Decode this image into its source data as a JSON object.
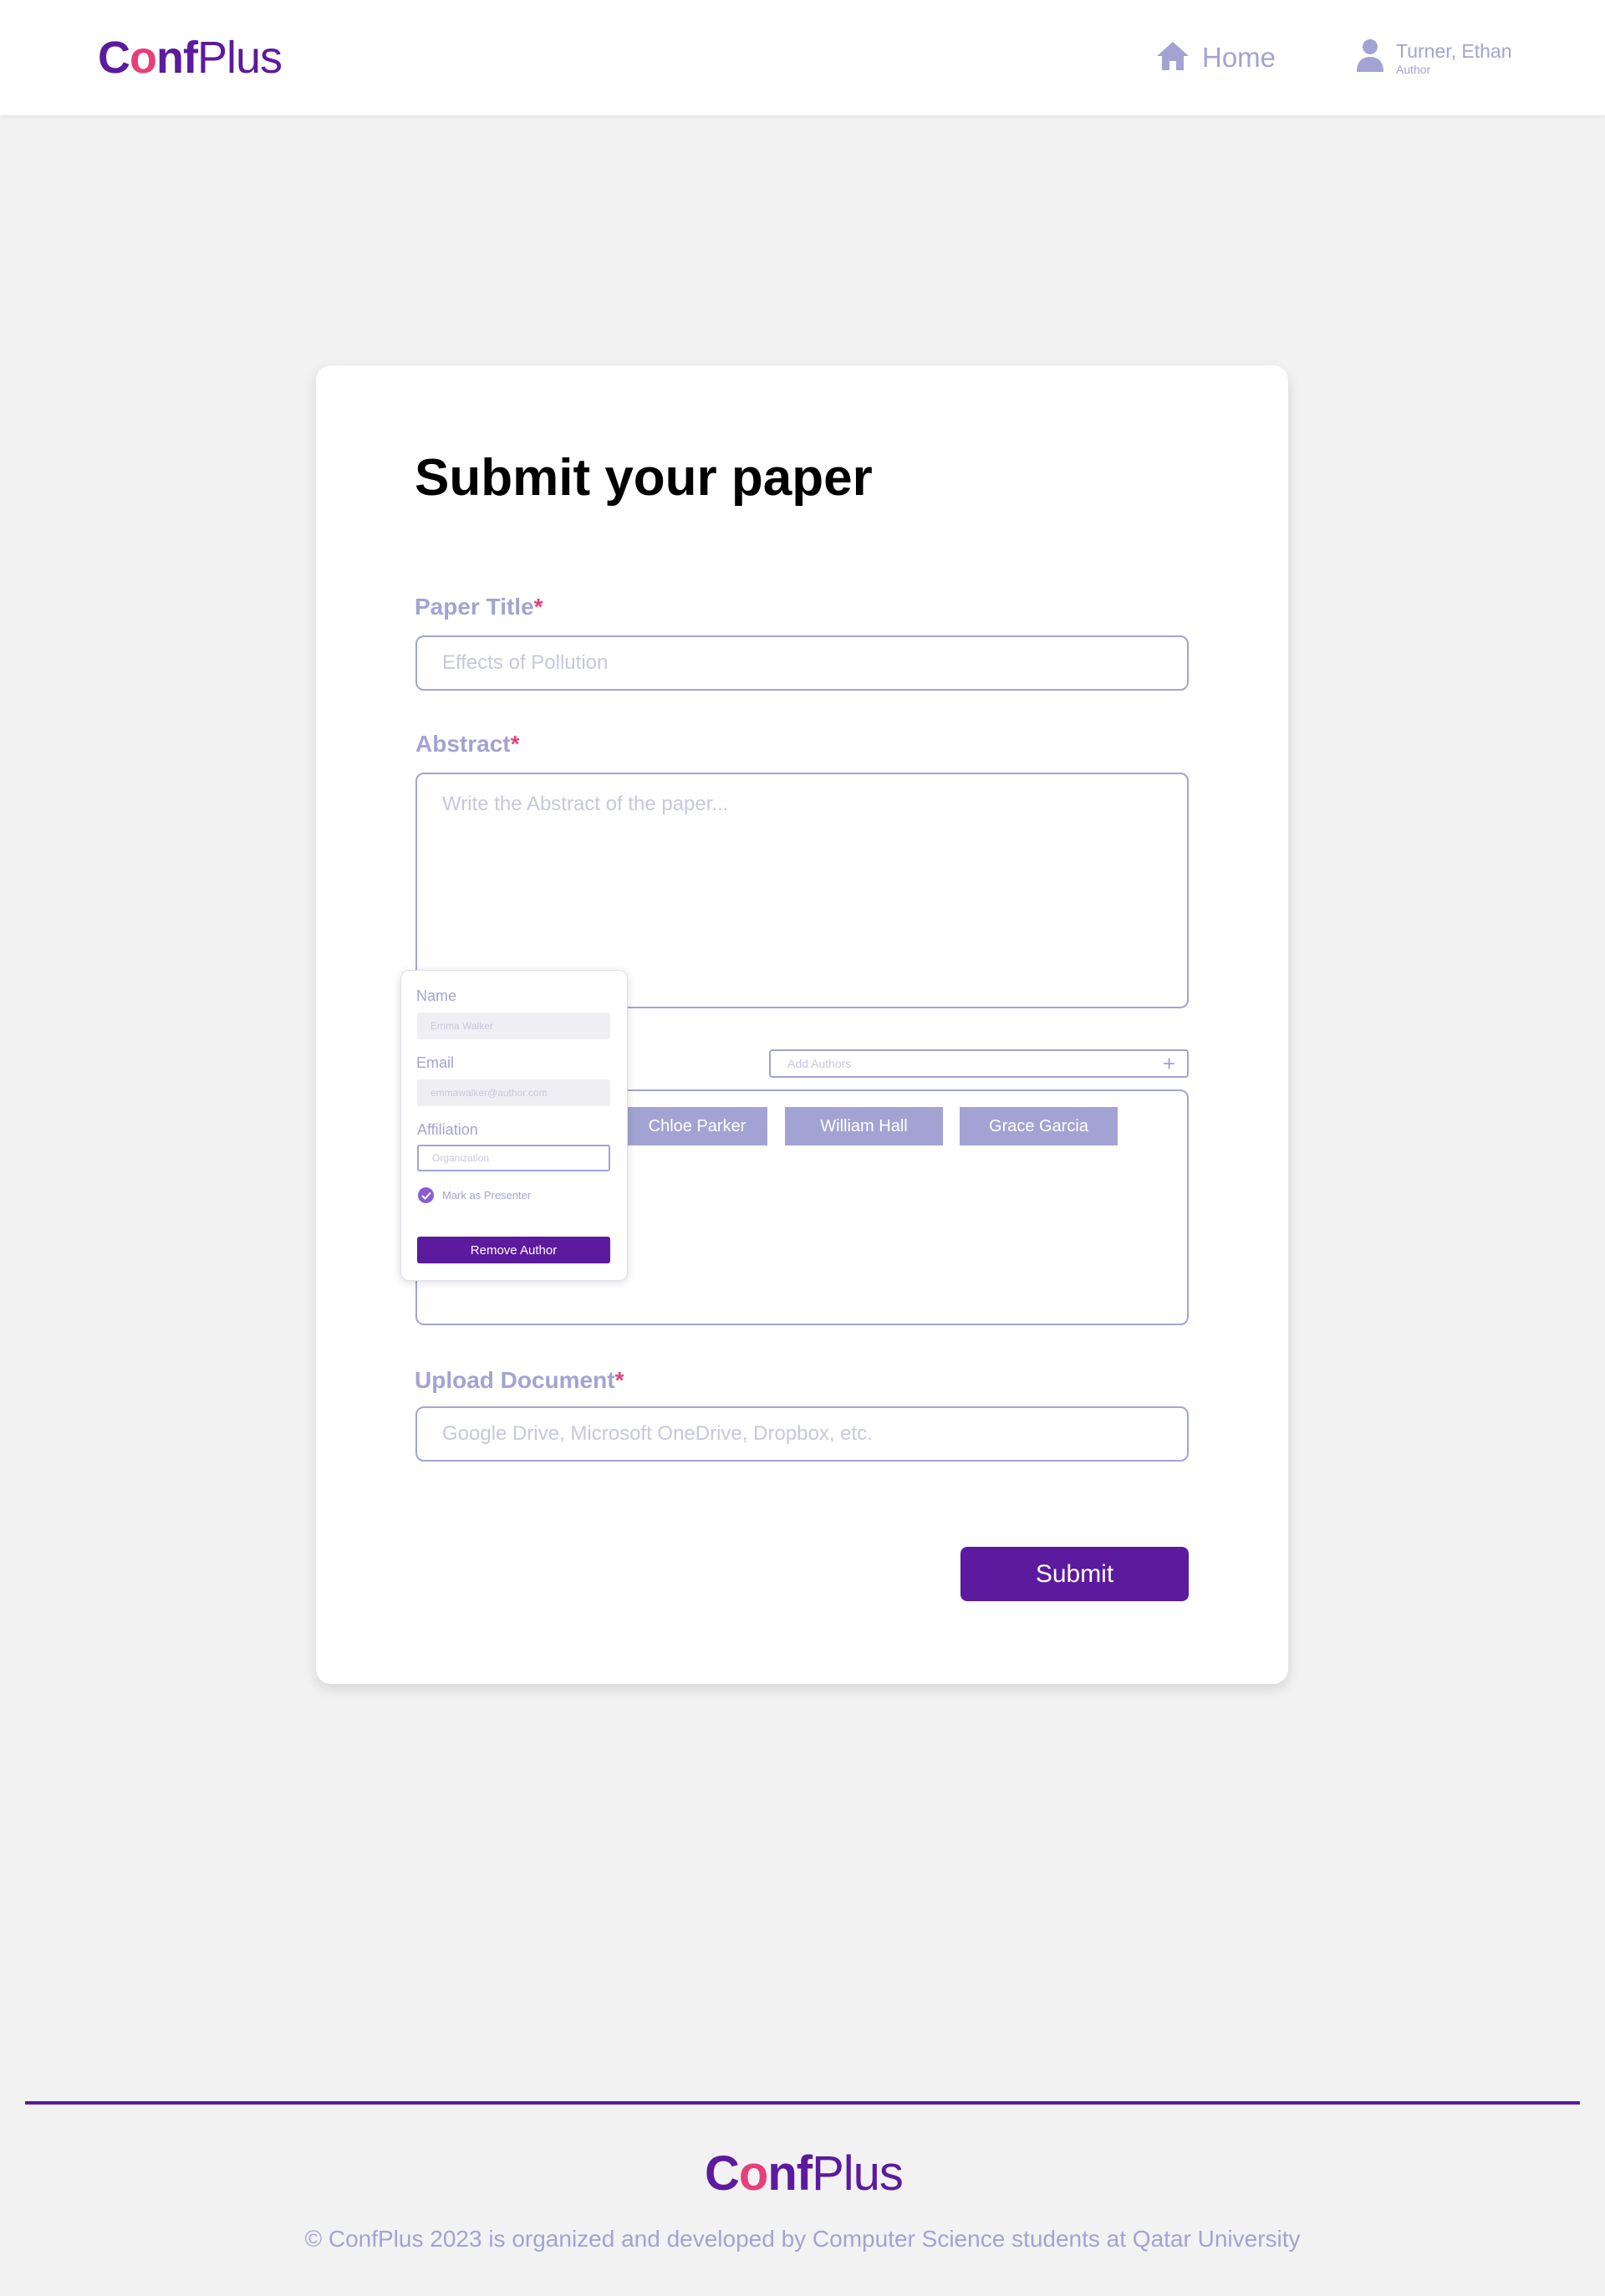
{
  "brand": {
    "conf_c": "C",
    "conf_o": "o",
    "conf_nf": "nf",
    "plus": "Plus"
  },
  "nav": {
    "home_label": "Home",
    "user_name": "Turner, Ethan",
    "user_role": "Author"
  },
  "form": {
    "title": "Submit your paper",
    "paper_title_label": "Paper Title",
    "paper_title_placeholder": "Effects of Pollution",
    "abstract_label": "Abstract",
    "abstract_placeholder": "Write the Abstract of the paper...",
    "add_authors_placeholder": "Add Authors",
    "authors": [
      "Chloe Parker",
      "William Hall",
      "Grace Garcia"
    ],
    "upload_label": "Upload Document",
    "upload_placeholder": "Google Drive, Microsoft OneDrive, Dropbox, etc.",
    "required_mark": "*",
    "submit_label": "Submit"
  },
  "author_popup": {
    "name_label": "Name",
    "name_value": "Emma Walker",
    "email_label": "Email",
    "email_value": "emmawalker@author.com",
    "affiliation_label": "Affiliation",
    "affiliation_placeholder": "Organization",
    "presenter_label": "Mark as Presenter",
    "remove_label": "Remove Author"
  },
  "footer": {
    "text": "© ConfPlus 2023 is organized and developed by Computer Science students at Qatar University"
  },
  "colors": {
    "brand_purple": "#5c1a9e",
    "brand_pink": "#e63f7a",
    "muted_lavender": "#a3a3d3",
    "background": "#f2f2f2"
  }
}
